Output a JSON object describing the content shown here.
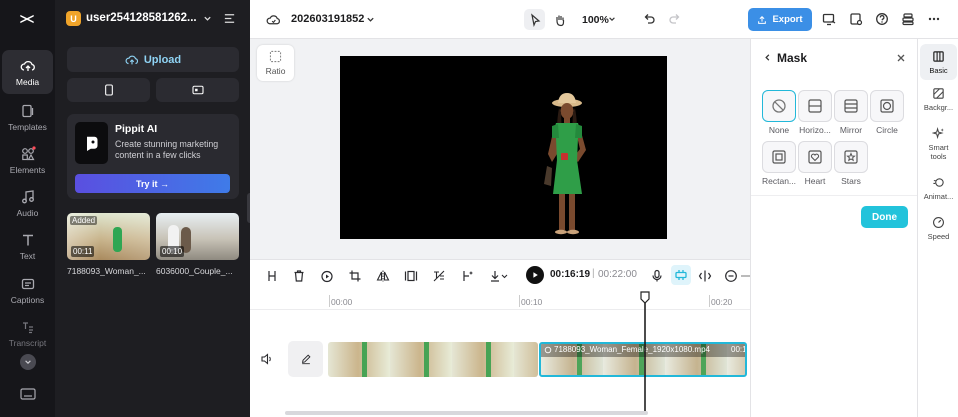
{
  "rail": {
    "items": [
      {
        "label": "Media",
        "icon": "cloud-upload-icon",
        "active": true
      },
      {
        "label": "Templates",
        "icon": "templates-icon"
      },
      {
        "label": "Elements",
        "icon": "elements-icon"
      },
      {
        "label": "Audio",
        "icon": "music-note-icon"
      },
      {
        "label": "Text",
        "icon": "text-icon"
      },
      {
        "label": "Captions",
        "icon": "captions-icon"
      },
      {
        "label": "Transcript",
        "icon": "transcript-icon"
      }
    ]
  },
  "panel": {
    "user_badge": "U",
    "user_name": "user254128581262...",
    "upload_label": "Upload",
    "promo": {
      "title": "Pippit AI",
      "text": "Create stunning marketing content in a few clicks",
      "button": "Try it →"
    },
    "media": [
      {
        "name": "7188093_Woman_...",
        "duration": "00:11",
        "badge": "Added"
      },
      {
        "name": "6036000_Couple_...",
        "duration": "00:10"
      }
    ]
  },
  "topbar": {
    "project_name": "202603191852",
    "zoom": "100%",
    "export_label": "Export"
  },
  "canvas": {
    "ratio_label": "Ratio"
  },
  "toolbar": {
    "current_time": "00:16:19",
    "separator": "|",
    "total_time": "00:22:00"
  },
  "timeline": {
    "ticks": [
      "00:00",
      "00:10",
      "00:20"
    ],
    "clip_label": "7188093_Woman_Female_1920x1080.mp4",
    "clip_time": "00:1"
  },
  "mask_panel": {
    "title": "Mask",
    "options": [
      "None",
      "Horizo...",
      "Mirror",
      "Circle",
      "Rectan...",
      "Heart",
      "Stars"
    ],
    "done_label": "Done"
  },
  "right_rail": {
    "items": [
      "Basic",
      "Backgr...",
      "Smart tools",
      "Animat...",
      "Speed"
    ]
  },
  "colors": {
    "accent": "#22b8d9",
    "export": "#3b8fe6",
    "promo_button": "#4f63e8"
  }
}
